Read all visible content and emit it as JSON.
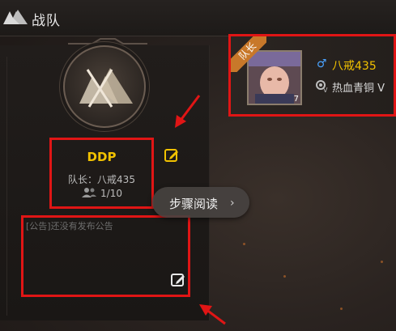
{
  "header": {
    "title": "战队",
    "logo_icon": "team-flag-icon"
  },
  "team": {
    "name": "DDP",
    "leader_label": "队长：八戒435",
    "member_count": "1/10",
    "notice_placeholder": "[公告]还没有发布公告"
  },
  "leader_card": {
    "ribbon": "队长",
    "gender": "♂",
    "name": "八戒435",
    "rank": "热血青铜 V",
    "avatar_level": "7"
  },
  "tooltip": {
    "label": "步骤阅读",
    "arrow": "›"
  },
  "colors": {
    "accent_gold": "#f2c200",
    "highlight_red": "#e01515",
    "ribbon_orange": "#c8782a",
    "gender_blue": "#4aa3ff"
  }
}
